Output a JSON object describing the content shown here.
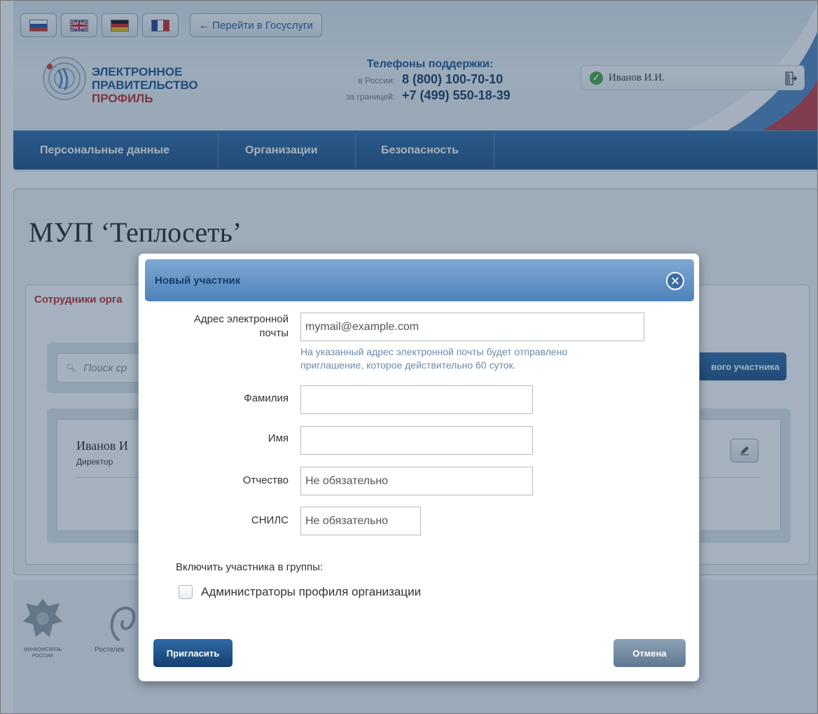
{
  "languages": [
    {
      "name": "russian-flag-icon"
    },
    {
      "name": "uk-flag-icon"
    },
    {
      "name": "german-flag-icon"
    },
    {
      "name": "french-flag-icon"
    }
  ],
  "header": {
    "goto_label": "← Перейти в Госуслуги",
    "logo_line1": "ЭЛЕКТРОННОЕ",
    "logo_line2": "ПРАВИТЕЛЬСТВО",
    "logo_line3": "ПРОФИЛЬ",
    "phones_title": "Телефоны поддержки:",
    "phone_ru_label": "в России:",
    "phone_ru": "8 (800) 100-70-10",
    "phone_abroad_label": "за границей:",
    "phone_abroad": "+7 (499) 550-18-39",
    "user_name": "Иванов И.И."
  },
  "nav": {
    "items": [
      "Персональные данные",
      "Организации",
      "Безопасность"
    ]
  },
  "page": {
    "org_title": "МУП ‘Теплосеть’",
    "panel_title": "Сотрудники орга",
    "search_placeholder": "Поиск ср",
    "add_button": "вого участника",
    "employee_name": "Иванов И",
    "employee_role": "Директор"
  },
  "footer": {
    "ministry": "МИНКОМСВЯЗЬ РОССИИ",
    "rostelecom": "Ростелек"
  },
  "modal": {
    "title": "Новый участник",
    "email_label": "Адрес электронной почты",
    "email_placeholder": "mymail@example.com",
    "email_value": "",
    "email_hint": "На указанный адрес электронной почты будет отправлено приглашение, которое действительно 60 суток.",
    "lastname_label": "Фамилия",
    "lastname_value": "",
    "firstname_label": "Имя",
    "firstname_value": "",
    "patronymic_label": "Отчество",
    "patronymic_placeholder": "Не обязательно",
    "snils_label": "СНИЛС",
    "snils_placeholder": "Не обязательно",
    "groups_label": "Включить участника в группы:",
    "group_admins_label": "Администраторы профиля организации",
    "group_admins_checked": false,
    "invite_button": "Пригласить",
    "cancel_button": "Отмена"
  },
  "colors": {
    "brand_blue": "#1b4f86",
    "accent_red": "#c2282a",
    "hint_blue": "#6a8aa8",
    "success_green": "#46a63f"
  }
}
